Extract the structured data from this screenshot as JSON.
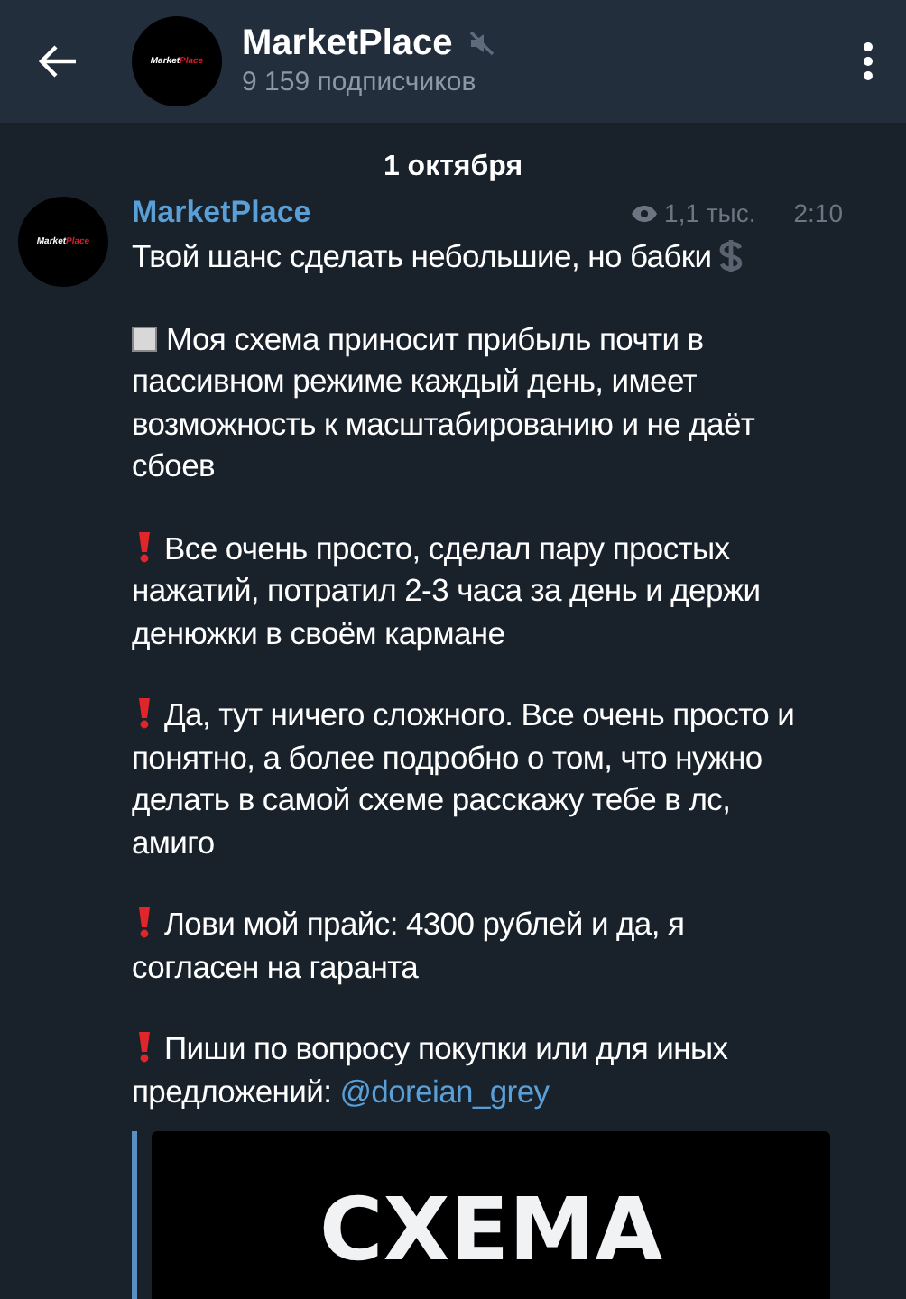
{
  "header": {
    "title": "MarketPlace",
    "muted": true,
    "subtitle": "9 159 подписчиков",
    "logo": {
      "part1": "Market",
      "part2": "Place"
    }
  },
  "date": "1 октября",
  "post": {
    "author": "MarketPlace",
    "logo": {
      "part1": "Market",
      "part2": "Place"
    },
    "views": "1,1 тыс.",
    "time": "2:10",
    "paragraphs": [
      {
        "kind": "plain",
        "text": "Твой шанс сделать небольшие, но бабки",
        "dollar_icon": true
      },
      {
        "kind": "square",
        "text": "Моя схема приносит прибыль почти в пассивном режиме каждый день, имеет возможность к масштабированию и не даёт сбоев"
      },
      {
        "kind": "exclamation",
        "text": "Все очень просто, сделал пару простых нажатий, потратил 2-3 часа за день и держи денюжки в своём кармане"
      },
      {
        "kind": "exclamation",
        "text": "Да, тут ничего сложного. Все очень просто и понятно, а более подробно о том, что нужно делать в самой схеме расскажу тебе в лс, амиго"
      },
      {
        "kind": "exclamation",
        "text": "Лови мой прайс: 4300 рублей и да, я согласен на гаранта"
      },
      {
        "kind": "exclamation",
        "text": "Пиши по вопросу покупки или для иных предложений: ",
        "link": "@doreian_grey"
      }
    ],
    "preview": {
      "title": "СХЕМА"
    }
  }
}
